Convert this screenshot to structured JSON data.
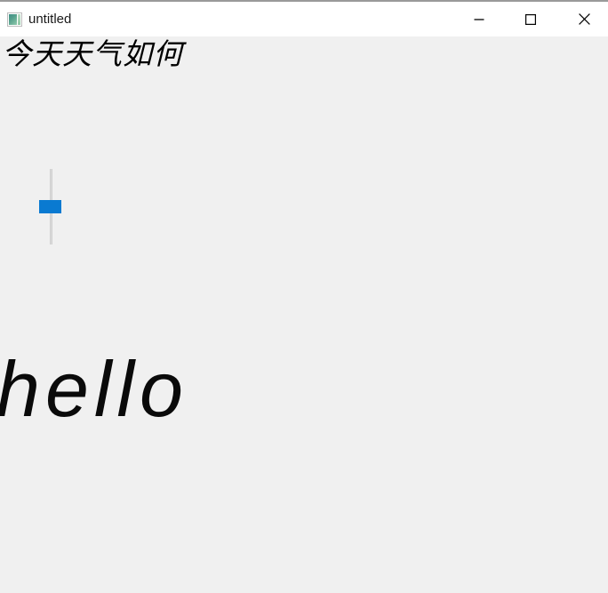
{
  "window": {
    "title": "untitled",
    "icon": "image-app-icon",
    "titlebar_background": "#ffffff",
    "content_background": "#f0f0f0",
    "controls": {
      "minimize": {
        "label": "Minimize",
        "icon": "minimize-icon"
      },
      "maximize": {
        "label": "Maximize",
        "icon": "maximize-icon"
      },
      "close": {
        "label": "Close",
        "icon": "close-icon"
      }
    }
  },
  "content": {
    "cjk_heading": {
      "text": "今天天气如何",
      "color": "#000000"
    },
    "slider": {
      "orientation": "vertical",
      "thumb_color": "#0a7ad1",
      "track_color": "#dcdcdc",
      "value_fraction": "0.55"
    },
    "hello_text": {
      "text": "hello",
      "color": "#0a0a0a"
    }
  }
}
